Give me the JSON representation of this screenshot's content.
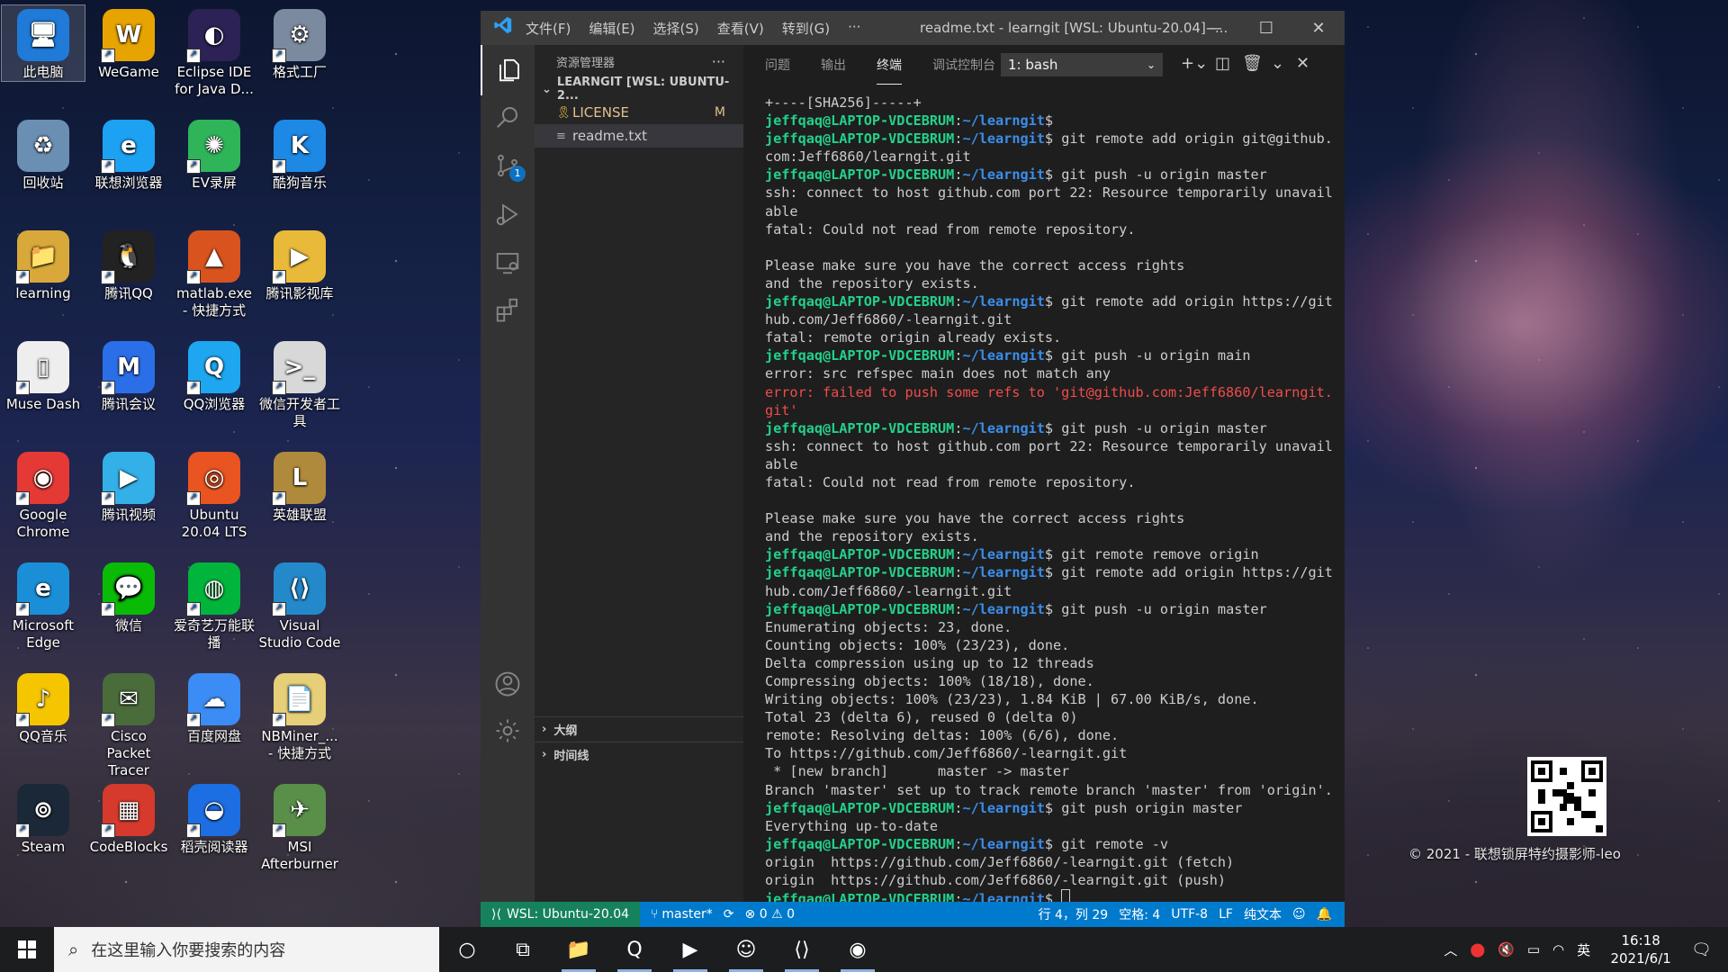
{
  "desktop": {
    "icons": [
      {
        "label": "此电脑",
        "glyph": "🖥",
        "color": "#1f7ad8"
      },
      {
        "label": "WeGame",
        "glyph": "W",
        "color": "#e7a400"
      },
      {
        "label": "Eclipse IDE for Java D...",
        "glyph": "◐",
        "color": "#2c2255"
      },
      {
        "label": "格式工厂",
        "glyph": "⚙",
        "color": "#7c8aa0"
      },
      {
        "label": "回收站",
        "glyph": "♻",
        "color": "#6b8fb3"
      },
      {
        "label": "联想浏览器",
        "glyph": "e",
        "color": "#1da1f2"
      },
      {
        "label": "EV录屏",
        "glyph": "✺",
        "color": "#2fb45a"
      },
      {
        "label": "酷狗音乐",
        "glyph": "K",
        "color": "#1e88e5"
      },
      {
        "label": "learning",
        "glyph": "📁",
        "color": "#d9a83a"
      },
      {
        "label": "腾讯QQ",
        "glyph": "🐧",
        "color": "#222222"
      },
      {
        "label": "matlab.exe - 快捷方式",
        "glyph": "▲",
        "color": "#d9531e"
      },
      {
        "label": "腾讯影视库",
        "glyph": "▶",
        "color": "#e9b93a"
      },
      {
        "label": "Muse Dash",
        "glyph": "▯",
        "color": "#eeeeee"
      },
      {
        "label": "腾讯会议",
        "glyph": "M",
        "color": "#2b6fe8"
      },
      {
        "label": "QQ浏览器",
        "glyph": "Q",
        "color": "#1ea6f0"
      },
      {
        "label": "微信开发者工具",
        "glyph": ">_",
        "color": "#d8d8d8"
      },
      {
        "label": "Google Chrome",
        "glyph": "◉",
        "color": "#e53935"
      },
      {
        "label": "腾讯视频",
        "glyph": "▶",
        "color": "#33b0e8"
      },
      {
        "label": "Ubuntu 20.04 LTS",
        "glyph": "◎",
        "color": "#e95420"
      },
      {
        "label": "英雄联盟",
        "glyph": "L",
        "color": "#b08a3c"
      },
      {
        "label": "Microsoft Edge",
        "glyph": "e",
        "color": "#1a8fd8"
      },
      {
        "label": "微信",
        "glyph": "💬",
        "color": "#09bb07"
      },
      {
        "label": "爱奇艺万能联播",
        "glyph": "◍",
        "color": "#00b43c"
      },
      {
        "label": "Visual Studio Code",
        "glyph": "⟨⟩",
        "color": "#2489ca"
      },
      {
        "label": "QQ音乐",
        "glyph": "♪",
        "color": "#f5c500"
      },
      {
        "label": "Cisco Packet Tracer",
        "glyph": "✉",
        "color": "#4a6b3a"
      },
      {
        "label": "百度网盘",
        "glyph": "☁",
        "color": "#3b8cf4"
      },
      {
        "label": "NBMiner_... - 快捷方式",
        "glyph": "📄",
        "color": "#e6cf78"
      },
      {
        "label": "Steam",
        "glyph": "⊚",
        "color": "#1b2838"
      },
      {
        "label": "CodeBlocks",
        "glyph": "▦",
        "color": "#d63a2c"
      },
      {
        "label": "稻壳阅读器",
        "glyph": "◒",
        "color": "#1d6ee3"
      },
      {
        "label": "MSI Afterburner",
        "glyph": "✈",
        "color": "#5a8f4a"
      }
    ],
    "credit": "© 2021 - 联想锁屏特约摄影师-leo"
  },
  "vscode": {
    "menu": [
      "文件(F)",
      "编辑(E)",
      "选择(S)",
      "查看(V)",
      "转到(G)",
      "···"
    ],
    "title": "readme.txt - learngit [WSL: Ubuntu-20.04] -...",
    "scm_badge": "1",
    "explorer": {
      "header": "资源管理器",
      "folder": "LEARNGIT [WSL: UBUNTU-2...",
      "files": [
        {
          "name": "LICENSE",
          "status": "M"
        },
        {
          "name": "readme.txt",
          "status": ""
        }
      ],
      "outline": "大纲",
      "timeline": "时间线"
    },
    "panel": {
      "tabs": [
        "问题",
        "输出",
        "终端",
        "调试控制台"
      ],
      "active_tab": "终端",
      "terminal_select": "1: bash"
    },
    "terminal": {
      "user": "jeffqaq@LAPTOP-VDCEBRUM",
      "path": "~/learngit",
      "lines": [
        {
          "t": "o",
          "text": "+----[SHA256]-----+"
        },
        {
          "t": "c",
          "cmd": ""
        },
        {
          "t": "c",
          "cmd": "git remote add origin git@github."
        },
        {
          "t": "o",
          "text": "com:Jeff6860/learngit.git"
        },
        {
          "t": "c",
          "cmd": "git push -u origin master"
        },
        {
          "t": "o",
          "text": "ssh: connect to host github.com port 22: Resource temporarily unavail"
        },
        {
          "t": "o",
          "text": "able"
        },
        {
          "t": "o",
          "text": "fatal: Could not read from remote repository."
        },
        {
          "t": "o",
          "text": ""
        },
        {
          "t": "o",
          "text": "Please make sure you have the correct access rights"
        },
        {
          "t": "o",
          "text": "and the repository exists."
        },
        {
          "t": "c",
          "cmd": "git remote add origin https://git"
        },
        {
          "t": "o",
          "text": "hub.com/Jeff6860/-learngit.git"
        },
        {
          "t": "o",
          "text": "fatal: remote origin already exists."
        },
        {
          "t": "c",
          "cmd": "git push -u origin main"
        },
        {
          "t": "o",
          "text": "error: src refspec main does not match any"
        },
        {
          "t": "e",
          "text": "error: failed to push some refs to 'git@github.com:Jeff6860/learngit."
        },
        {
          "t": "e",
          "text": "git'"
        },
        {
          "t": "c",
          "cmd": "git push -u origin master"
        },
        {
          "t": "o",
          "text": "ssh: connect to host github.com port 22: Resource temporarily unavail"
        },
        {
          "t": "o",
          "text": "able"
        },
        {
          "t": "o",
          "text": "fatal: Could not read from remote repository."
        },
        {
          "t": "o",
          "text": ""
        },
        {
          "t": "o",
          "text": "Please make sure you have the correct access rights"
        },
        {
          "t": "o",
          "text": "and the repository exists."
        },
        {
          "t": "c",
          "cmd": "git remote remove origin"
        },
        {
          "t": "c",
          "cmd": "git remote add origin https://git"
        },
        {
          "t": "o",
          "text": "hub.com/Jeff6860/-learngit.git"
        },
        {
          "t": "c",
          "cmd": "git push -u origin master"
        },
        {
          "t": "o",
          "text": "Enumerating objects: 23, done."
        },
        {
          "t": "o",
          "text": "Counting objects: 100% (23/23), done."
        },
        {
          "t": "o",
          "text": "Delta compression using up to 12 threads"
        },
        {
          "t": "o",
          "text": "Compressing objects: 100% (18/18), done."
        },
        {
          "t": "o",
          "text": "Writing objects: 100% (23/23), 1.84 KiB | 67.00 KiB/s, done."
        },
        {
          "t": "o",
          "text": "Total 23 (delta 6), reused 0 (delta 0)"
        },
        {
          "t": "o",
          "text": "remote: Resolving deltas: 100% (6/6), done."
        },
        {
          "t": "o",
          "text": "To https://github.com/Jeff6860/-learngit.git"
        },
        {
          "t": "o",
          "text": " * [new branch]      master -> master"
        },
        {
          "t": "o",
          "text": "Branch 'master' set up to track remote branch 'master' from 'origin'."
        },
        {
          "t": "c",
          "cmd": "git push origin master"
        },
        {
          "t": "o",
          "text": "Everything up-to-date"
        },
        {
          "t": "c",
          "cmd": "git remote -v"
        },
        {
          "t": "o",
          "text": "origin  https://github.com/Jeff6860/-learngit.git (fetch)"
        },
        {
          "t": "o",
          "text": "origin  https://github.com/Jeff6860/-learngit.git (push)"
        },
        {
          "t": "c",
          "cmd": "",
          "cursor": true
        }
      ]
    },
    "statusbar": {
      "remote": "WSL: Ubuntu-20.04",
      "branch": "master*",
      "problems": "⊗ 0 ⚠ 0",
      "position": "行 4，列 29",
      "spaces": "空格: 4",
      "encoding": "UTF-8",
      "eol": "LF",
      "language": "纯文本"
    }
  },
  "taskbar": {
    "search_placeholder": "在这里输入你要搜索的内容",
    "apps": [
      {
        "name": "cortana",
        "glyph": "○",
        "open": false
      },
      {
        "name": "task-view",
        "glyph": "⧉",
        "open": false
      },
      {
        "name": "file-explorer",
        "glyph": "📁",
        "open": true
      },
      {
        "name": "qq-browser",
        "glyph": "Q",
        "open": true
      },
      {
        "name": "tencent-video",
        "glyph": "▶",
        "open": true
      },
      {
        "name": "user-app",
        "glyph": "☺",
        "open": true
      },
      {
        "name": "vscode",
        "glyph": "⟨⟩",
        "open": true
      },
      {
        "name": "chrome",
        "glyph": "◉",
        "open": true
      }
    ],
    "ime": "英",
    "time": "16:18",
    "date": "2021/6/1"
  }
}
